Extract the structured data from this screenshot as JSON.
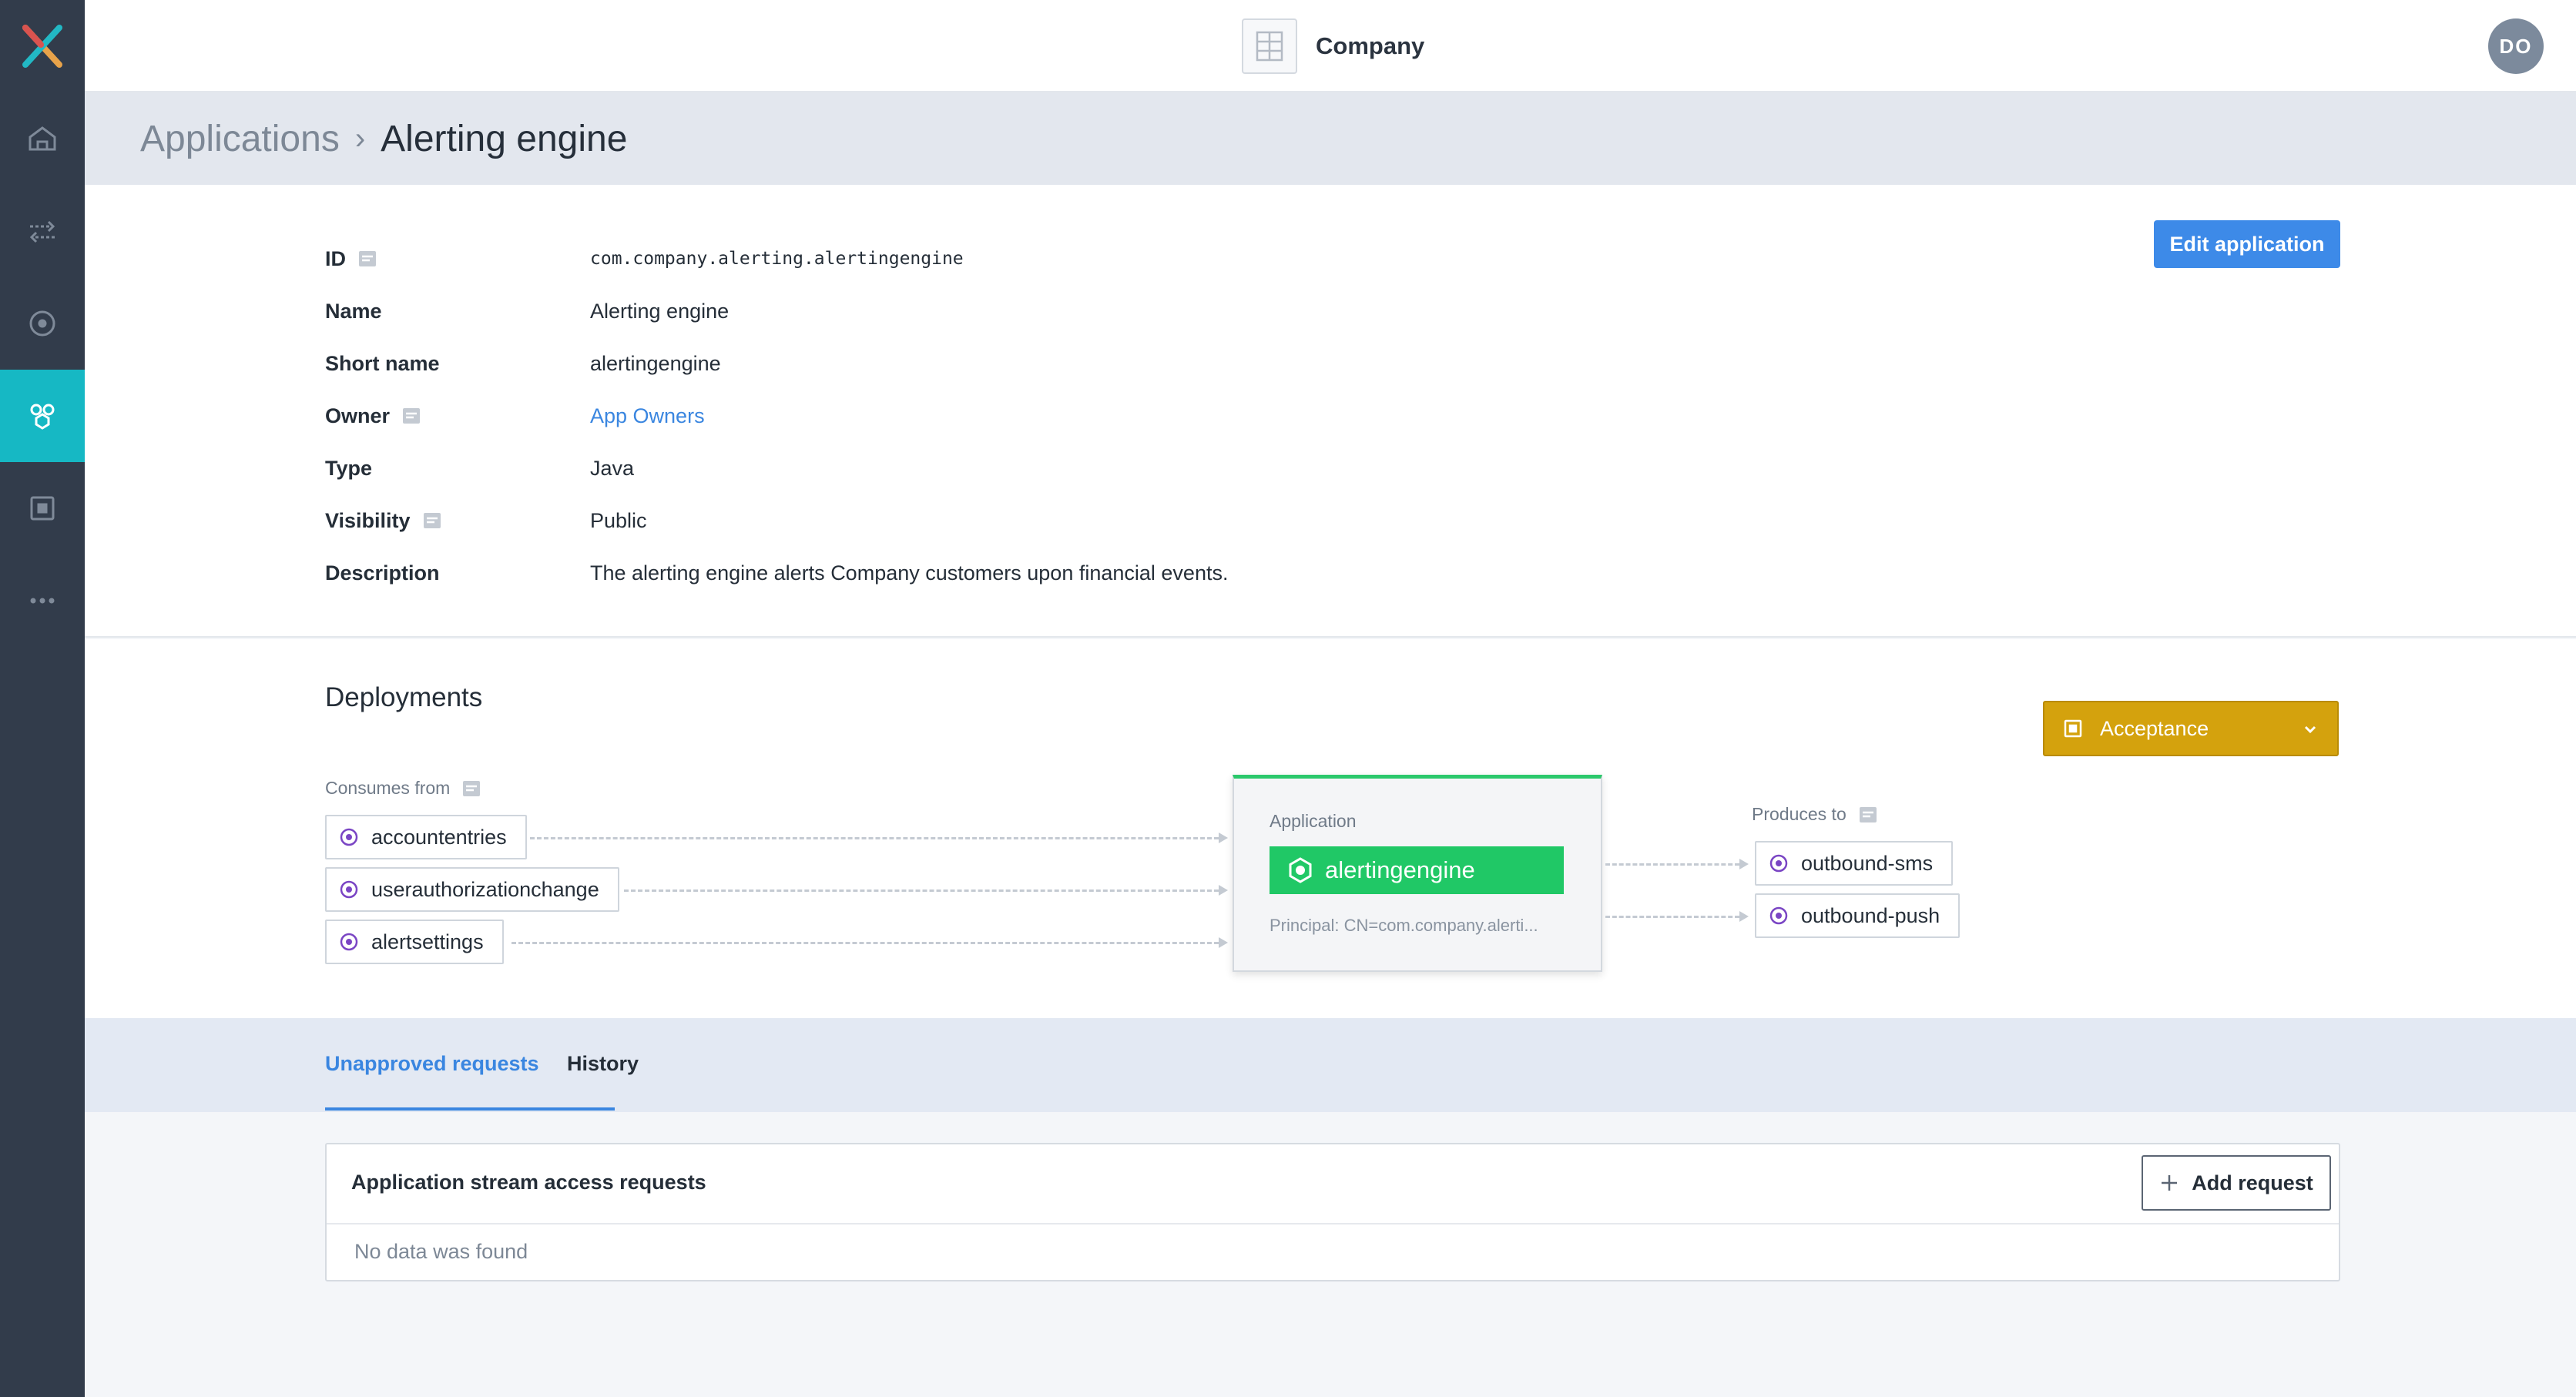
{
  "sidebar": {
    "items": [
      {
        "icon": "home-icon"
      },
      {
        "icon": "transfer-icon"
      },
      {
        "icon": "stream-icon"
      },
      {
        "icon": "applications-icon",
        "active": true
      },
      {
        "icon": "environment-icon"
      },
      {
        "icon": "more-icon"
      }
    ]
  },
  "header": {
    "company": "Company",
    "avatar_initials": "DO"
  },
  "breadcrumb": {
    "parent": "Applications",
    "separator": "›",
    "current": "Alerting engine"
  },
  "details": {
    "edit_button": "Edit application",
    "fields": {
      "id": {
        "label": "ID",
        "value": "com.company.alerting.alertingengine"
      },
      "name": {
        "label": "Name",
        "value": "Alerting engine"
      },
      "short_name": {
        "label": "Short name",
        "value": "alertingengine"
      },
      "owner": {
        "label": "Owner",
        "value": "App Owners"
      },
      "type": {
        "label": "Type",
        "value": "Java"
      },
      "visibility": {
        "label": "Visibility",
        "value": "Public"
      },
      "description": {
        "label": "Description",
        "value": "The alerting engine alerts Company customers upon financial events."
      }
    }
  },
  "deployments": {
    "title": "Deployments",
    "environment": "Acceptance",
    "consumes_label": "Consumes from",
    "produces_label": "Produces to",
    "consumes": [
      "accountentries",
      "userauthorizationchange",
      "alertsettings"
    ],
    "produces": [
      "outbound-sms",
      "outbound-push"
    ],
    "app_card": {
      "caption": "Application",
      "name": "alertingengine",
      "principal": "Principal: CN=com.company.alerti..."
    }
  },
  "tabs": {
    "unapproved": "Unapproved requests",
    "history": "History"
  },
  "requests": {
    "title": "Application stream access requests",
    "add_button": "Add request",
    "empty": "No data was found"
  },
  "colors": {
    "sidebar": "#323c4b",
    "active": "#16b8c4",
    "primary": "#3d8ae8",
    "environment": "#d4a20d",
    "app_chip": "#20c866"
  }
}
